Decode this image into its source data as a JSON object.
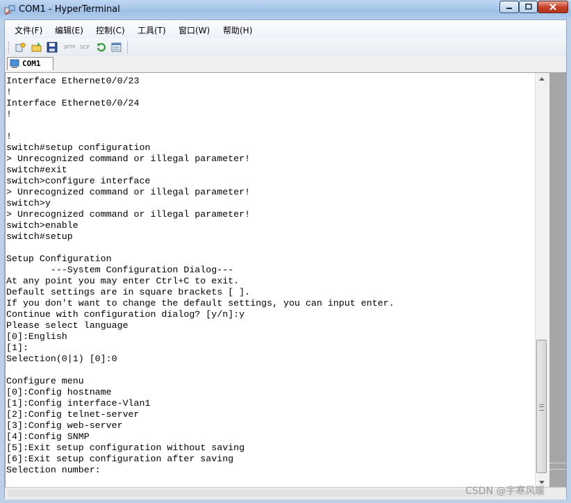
{
  "window": {
    "title": "COM1 - HyperTerminal"
  },
  "menu": [
    {
      "label": "文件(F)",
      "name": "menu-file"
    },
    {
      "label": "编辑(E)",
      "name": "menu-edit"
    },
    {
      "label": "控制(C)",
      "name": "menu-control"
    },
    {
      "label": "工具(T)",
      "name": "menu-tools"
    },
    {
      "label": "窗口(W)",
      "name": "menu-window"
    },
    {
      "label": "帮助(H)",
      "name": "menu-help"
    }
  ],
  "toolbar": {
    "sftp_label": "SFTP",
    "scp_label": "SCP",
    "icons": [
      "new-connection-icon",
      "open-icon",
      "save-icon",
      "sftp-icon",
      "scp-icon",
      "refresh-icon",
      "properties-icon"
    ]
  },
  "tab": {
    "label": "COM1"
  },
  "terminal": {
    "lines": [
      "Interface Ethernet0/0/23",
      "!",
      "Interface Ethernet0/0/24",
      "!",
      "",
      "!",
      "switch#setup configuration",
      "> Unrecognized command or illegal parameter!",
      "switch#exit",
      "switch>configure interface",
      "> Unrecognized command or illegal parameter!",
      "switch>y",
      "> Unrecognized command or illegal parameter!",
      "switch>enable",
      "switch#setup",
      "",
      "Setup Configuration",
      "        ---System Configuration Dialog---",
      "At any point you may enter Ctrl+C to exit.",
      "Default settings are in square brackets [ ].",
      "If you don't want to change the default settings, you can input enter.",
      "Continue with configuration dialog? [y/n]:y",
      "Please select language",
      "[0]:English",
      "[1]:",
      "Selection(0|1) [0]:0",
      "",
      "Configure menu",
      "[0]:Config hostname",
      "[1]:Config interface-Vlan1",
      "[2]:Config telnet-server",
      "[3]:Config web-server",
      "[4]:Config SNMP",
      "[5]:Exit setup configuration without saving",
      "[6]:Exit setup configuration after saving",
      "Selection number:"
    ]
  },
  "watermark": "CSDN @宇寒风暖",
  "colors": {
    "title_bar": "#a9c7ea",
    "close_button": "#c8432a",
    "terminal_bg": "#ffffff"
  }
}
